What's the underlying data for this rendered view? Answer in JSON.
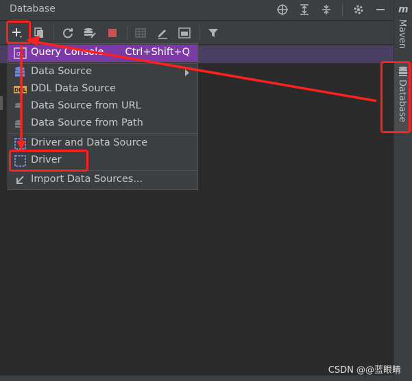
{
  "panel": {
    "title": "Database"
  },
  "right_tabs": {
    "maven": "Maven",
    "database": "Database"
  },
  "menu": {
    "items": [
      {
        "label": "Query Console",
        "shortcut": "Ctrl+Shift+Q",
        "icon": "ql-console-icon",
        "highlighted": true
      },
      {
        "label": "Data Source",
        "icon": "database-icon",
        "submenu": true
      },
      {
        "label": "DDL Data Source",
        "icon": "ddl-icon"
      },
      {
        "label": "Data Source from URL",
        "icon": "url-icon"
      },
      {
        "label": "Data Source from Path",
        "icon": "path-icon"
      },
      {
        "label": "Driver and Data Source",
        "icon": "driver-datasource-icon"
      },
      {
        "label": "Driver",
        "icon": "driver-icon"
      },
      {
        "label": "Import Data Sources...",
        "icon": "import-icon"
      }
    ]
  },
  "colors": {
    "highlight": "#7b3aa5",
    "annotation": "#ff2020"
  },
  "watermark": "CSDN @@蓝眼睛"
}
